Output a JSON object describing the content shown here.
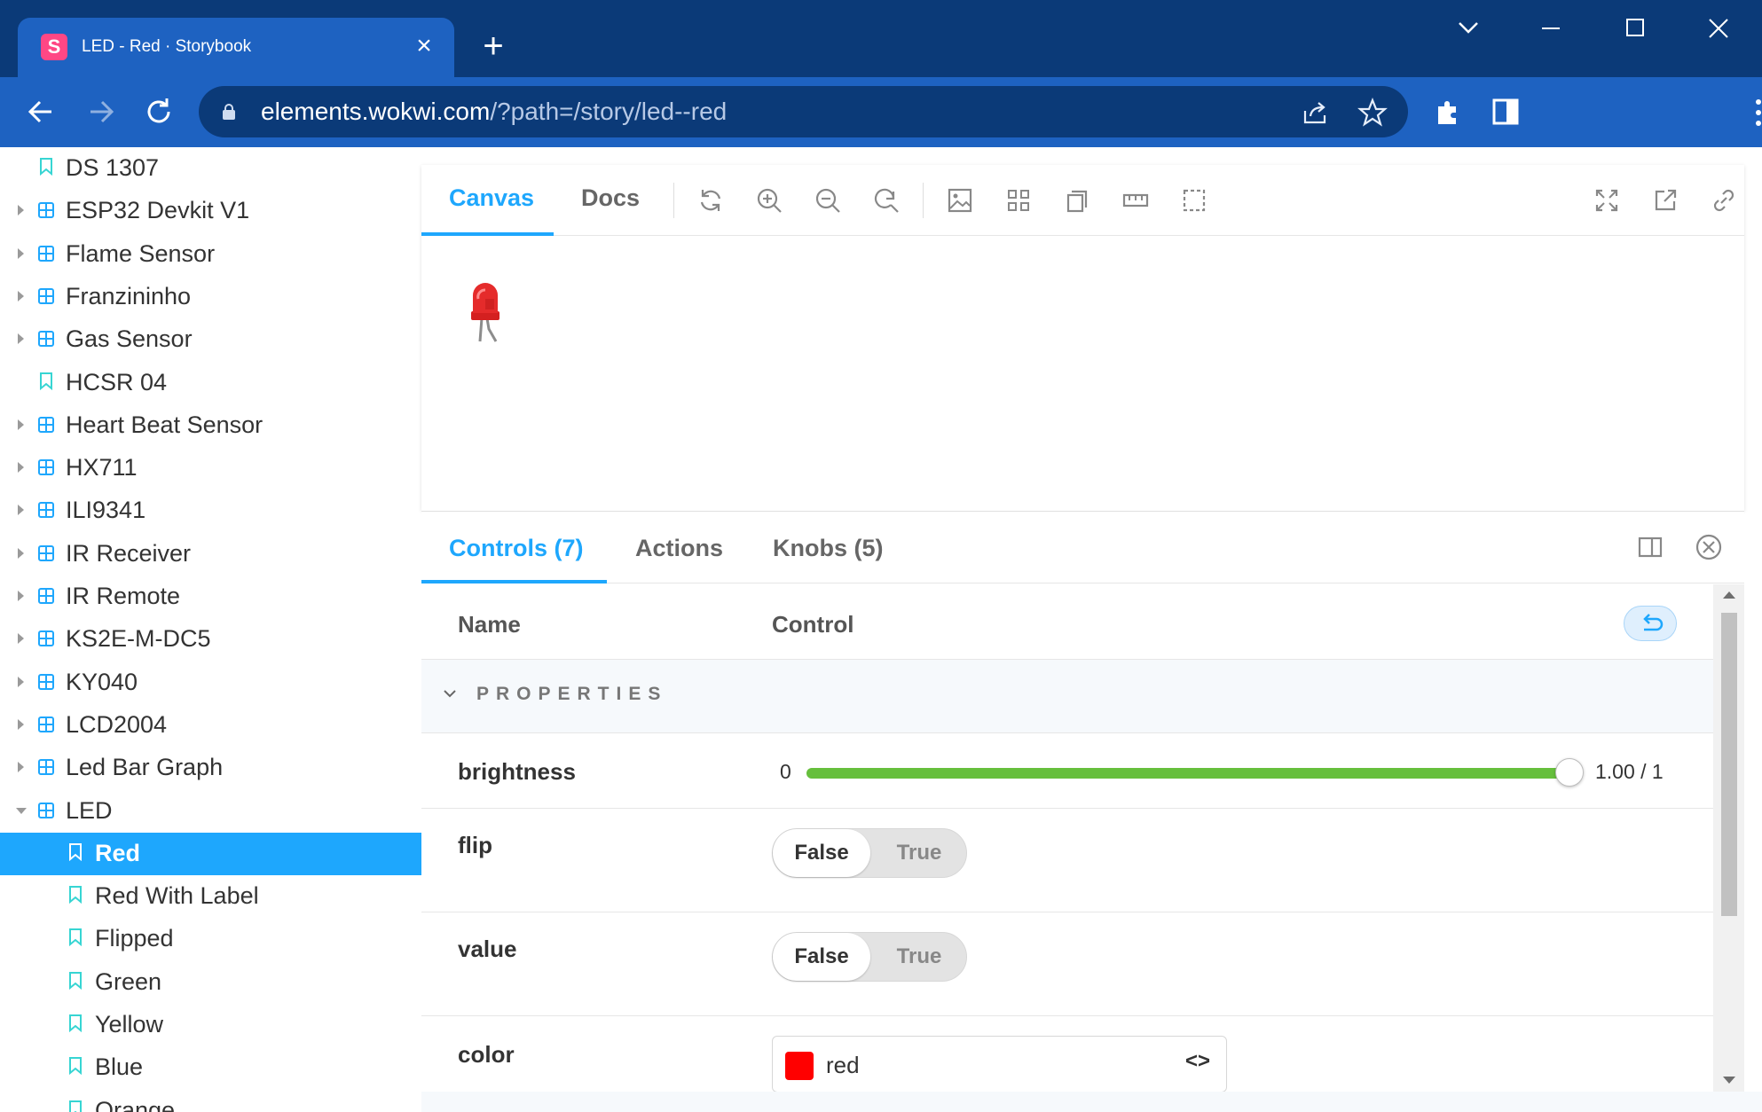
{
  "browser": {
    "tab_title": "LED - Red · Storybook",
    "favicon_letter": "S",
    "url_host": "elements.wokwi.com",
    "url_path": "/?path=/story/led--red",
    "accent": "#1e62c1"
  },
  "sidebar": {
    "items": [
      {
        "label": "DS 1307",
        "kind": "story-top"
      },
      {
        "label": "ESP32 Devkit V1",
        "kind": "component"
      },
      {
        "label": "Flame Sensor",
        "kind": "component"
      },
      {
        "label": "Franzininho",
        "kind": "component"
      },
      {
        "label": "Gas Sensor",
        "kind": "component"
      },
      {
        "label": "HCSR 04",
        "kind": "story-top"
      },
      {
        "label": "Heart Beat Sensor",
        "kind": "component"
      },
      {
        "label": "HX711",
        "kind": "component"
      },
      {
        "label": "ILI9341",
        "kind": "component"
      },
      {
        "label": "IR Receiver",
        "kind": "component"
      },
      {
        "label": "IR Remote",
        "kind": "component"
      },
      {
        "label": "KS2E-M-DC5",
        "kind": "component"
      },
      {
        "label": "KY040",
        "kind": "component"
      },
      {
        "label": "LCD2004",
        "kind": "component"
      },
      {
        "label": "Led Bar Graph",
        "kind": "component"
      },
      {
        "label": "LED",
        "kind": "component-open"
      },
      {
        "label": "Red",
        "kind": "story",
        "selected": true
      },
      {
        "label": "Red With Label",
        "kind": "story"
      },
      {
        "label": "Flipped",
        "kind": "story"
      },
      {
        "label": "Green",
        "kind": "story"
      },
      {
        "label": "Yellow",
        "kind": "story"
      },
      {
        "label": "Blue",
        "kind": "story"
      },
      {
        "label": "Orange",
        "kind": "story"
      }
    ],
    "selected_color": "#1ea7fd"
  },
  "preview": {
    "tabs": {
      "canvas": "Canvas",
      "docs": "Docs"
    },
    "tools": [
      "reload-icon",
      "zoom-in-icon",
      "zoom-out-icon",
      "zoom-reset-icon",
      "background-icon",
      "grid-icon",
      "viewport-icon",
      "measure-icon",
      "outline-icon",
      "fullscreen-icon",
      "open-new-tab-icon",
      "copy-link-icon"
    ]
  },
  "addons": {
    "tabs": {
      "controls": "Controls (7)",
      "actions": "Actions",
      "knobs": "Knobs (5)"
    },
    "headers": {
      "name": "Name",
      "control": "Control"
    },
    "section": "PROPERTIES",
    "brightness": {
      "name": "brightness",
      "min": "0",
      "max_label": "1.00 / 1",
      "value": 1.0
    },
    "flip": {
      "name": "flip",
      "false_label": "False",
      "true_label": "True",
      "value": false
    },
    "value": {
      "name": "value",
      "false_label": "False",
      "true_label": "True",
      "value": false
    },
    "color": {
      "name": "color",
      "text": "red",
      "swatch": "#ff0000",
      "code_icon": "<>"
    }
  }
}
